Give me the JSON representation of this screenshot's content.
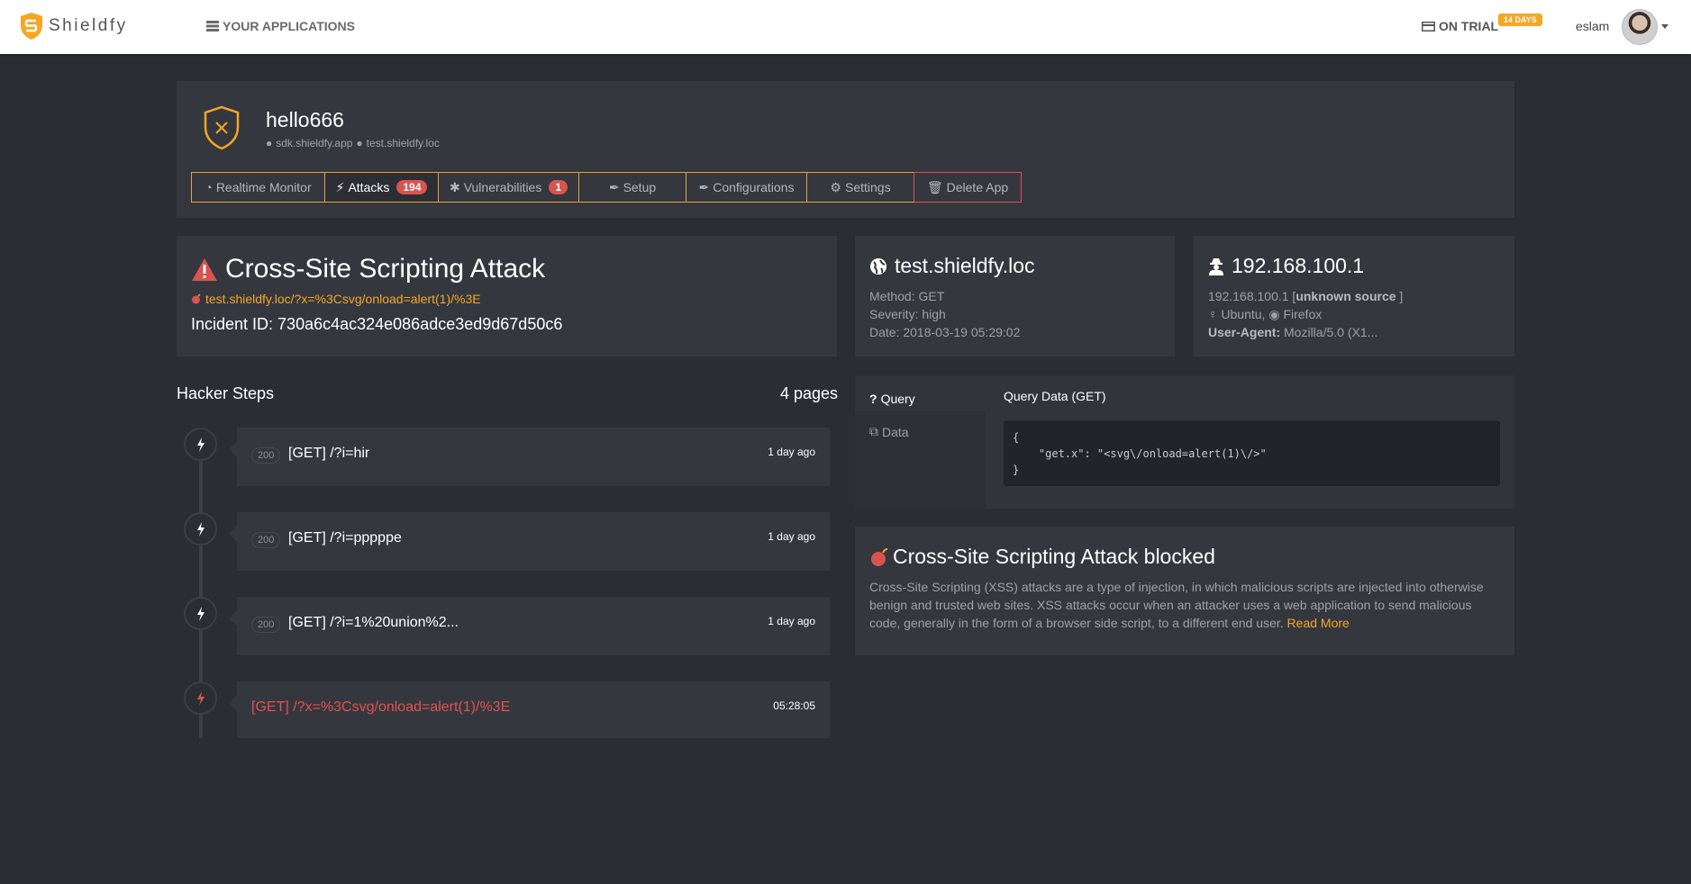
{
  "navbar": {
    "brand": "Shieldfy",
    "apps_link": "YOUR APPLICATIONS",
    "trial_label": "ON TRIAL",
    "trial_badge": "14 DAYS",
    "username": "eslam"
  },
  "app": {
    "name": "hello666",
    "domain1": "sdk.shieldfy.app",
    "domain2": "test.shieldfy.loc",
    "tabs": [
      {
        "label": "Realtime Monitor",
        "icon": "dashboard-icon"
      },
      {
        "label": "Attacks",
        "icon": "bolt-icon",
        "badge": "194"
      },
      {
        "label": "Vulnerabilities",
        "icon": "bug-icon",
        "badge": "1"
      },
      {
        "label": "Setup",
        "icon": "wrench-icon"
      },
      {
        "label": "Configurations",
        "icon": "wrench-icon"
      },
      {
        "label": "Settings",
        "icon": "gears-icon"
      },
      {
        "label": "Delete App",
        "icon": "trash-icon"
      }
    ]
  },
  "attack": {
    "title": "Cross-Site Scripting Attack",
    "url": "test.shieldfy.loc/?x=%3Csvg/onload=alert(1)/%3E",
    "incident": "Incident ID: 730a6c4ac324e086adce3ed9d67d50c6"
  },
  "host": {
    "title": "test.shieldfy.loc",
    "method": "Method: GET",
    "severity": "Severity: high",
    "date": "Date: 2018-03-19 05:29:02"
  },
  "ip": {
    "title": "192.168.100.1",
    "address": "192.168.100.1 [",
    "source": "unknown source",
    "address_close": " ]",
    "os": "Ubuntu,",
    "browser": "Firefox",
    "ua_label": "User-Agent:",
    "ua_value": "Mozilla/5.0 (X1..."
  },
  "steps": {
    "title": "Hacker Steps",
    "pages": "4 pages",
    "items": [
      {
        "status": "200",
        "request": "[GET] /?i=hir",
        "time": "1 day ago"
      },
      {
        "status": "200",
        "request": "[GET] /?i=pppppe",
        "time": "1 day ago"
      },
      {
        "status": "200",
        "request": "[GET] /?i=1%20union%2...",
        "time": "1 day ago"
      },
      {
        "status": "",
        "request": "[GET] /?x=%3Csvg/onload=alert(1)/%3E",
        "time": "05:28:05"
      }
    ]
  },
  "query": {
    "tab_query": "Query",
    "tab_data": "Data",
    "heading": "Query Data (GET)",
    "code_open": "{",
    "code_line": "    \"get.x\": \"<svg\\/onload=alert(1)\\/>\"",
    "code_close": "}"
  },
  "info": {
    "title": "Cross-Site Scripting Attack blocked",
    "text": "Cross-Site Scripting (XSS) attacks are a type of injection, in which malicious scripts are injected into otherwise benign and trusted web sites. XSS attacks occur when an attacker uses a web application to send malicious code, generally in the form of a browser side script, to a different end user. ",
    "link": "Read More"
  },
  "colors": {
    "accent": "#f5a623",
    "danger": "#d9534f",
    "background": "#2b2d35",
    "panel": "#35373f"
  }
}
